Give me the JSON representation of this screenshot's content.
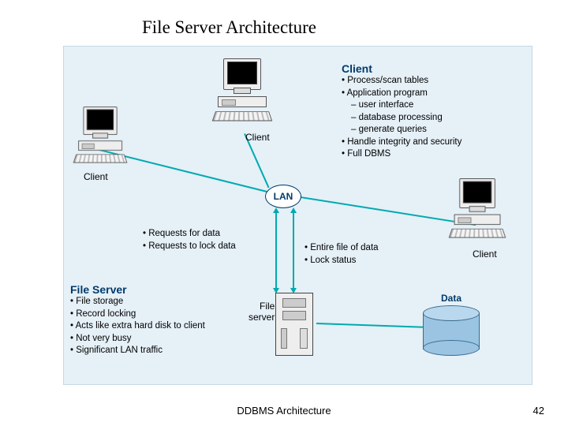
{
  "title": "File Server Architecture",
  "footer": "DDBMS Architecture",
  "page": "42",
  "labels": {
    "client_top": "Client",
    "client_left": "Client",
    "client_right": "Client",
    "lan": "LAN",
    "file_server_caption": "File\nserver",
    "data": "Data"
  },
  "client_box": {
    "heading": "Client",
    "items": [
      "Process/scan tables",
      "Application program"
    ],
    "subitems": [
      "user interface",
      "database processing",
      "generate queries"
    ],
    "items2": [
      "Handle integrity and security",
      "Full DBMS"
    ]
  },
  "left_flow": {
    "items": [
      "Requests for data",
      "Requests to lock data"
    ]
  },
  "right_flow": {
    "items": [
      "Entire file of data",
      "Lock status"
    ]
  },
  "fileserver_box": {
    "heading": "File Server",
    "items": [
      "File storage",
      "Record locking",
      "Acts like extra hard disk to client",
      "Not very busy",
      "Significant LAN traffic"
    ]
  }
}
